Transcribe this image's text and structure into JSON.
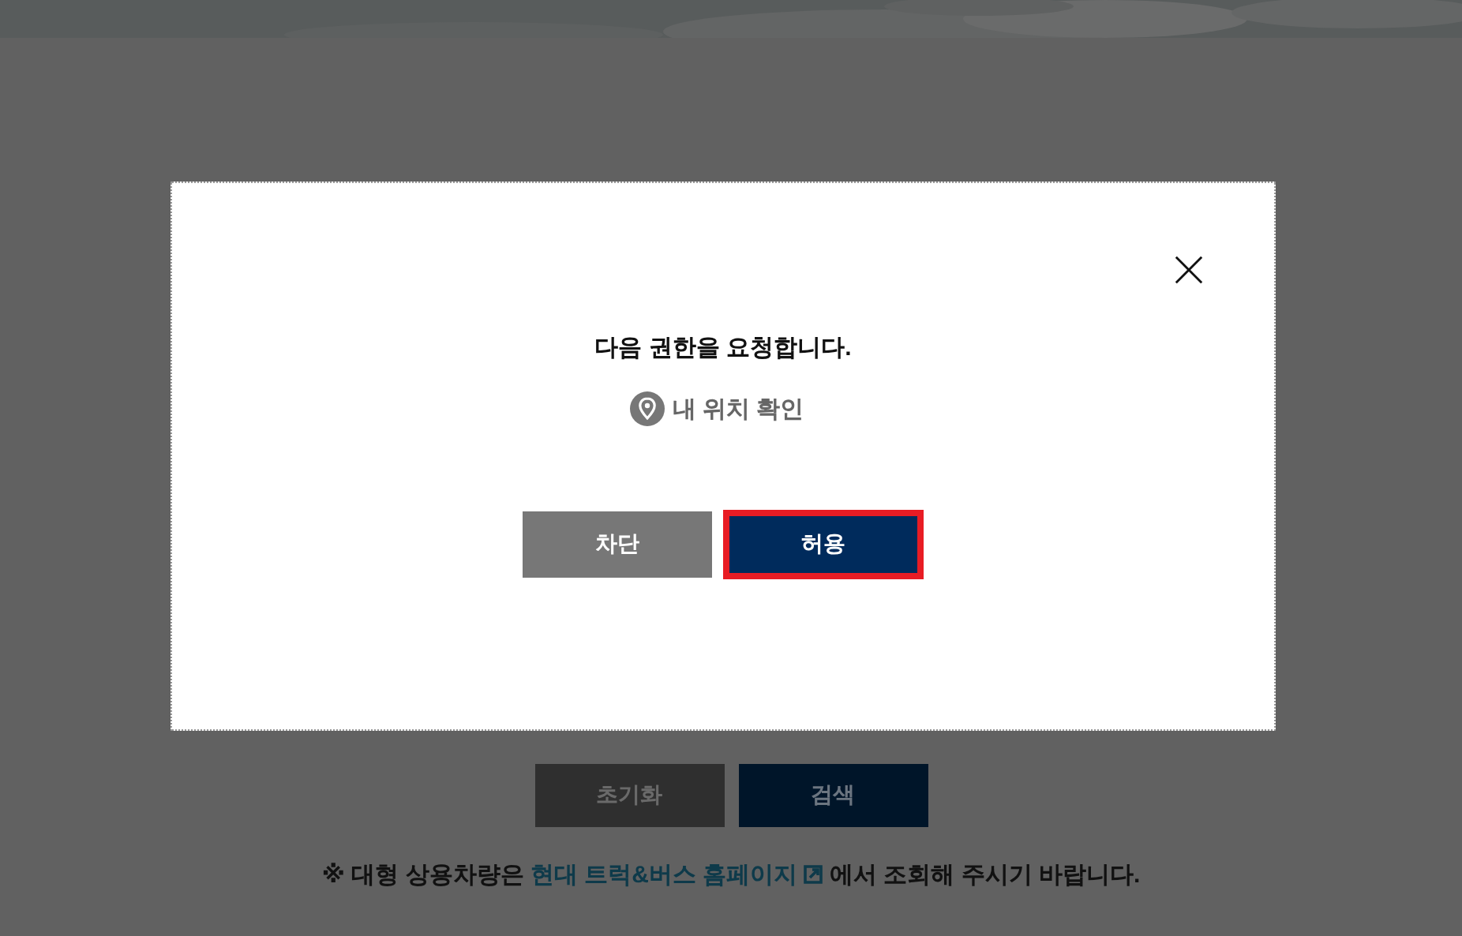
{
  "page": {
    "buttons": [
      {
        "label": "초기화",
        "kind": "reset"
      },
      {
        "label": "검색",
        "kind": "search"
      }
    ],
    "note": {
      "prefix": "※ 대형 상용차량은",
      "link": "현대 트럭&버스 홈페이지",
      "suffix": "에서 조회해 주시기 바랍니다."
    }
  },
  "dialog": {
    "message": "다음 권한을 요청합니다.",
    "permission": "내 위치 확인",
    "buttons": [
      {
        "label": "차단",
        "kind": "deny",
        "focused": false
      },
      {
        "label": "허용",
        "kind": "allow",
        "focused": true
      }
    ]
  }
}
